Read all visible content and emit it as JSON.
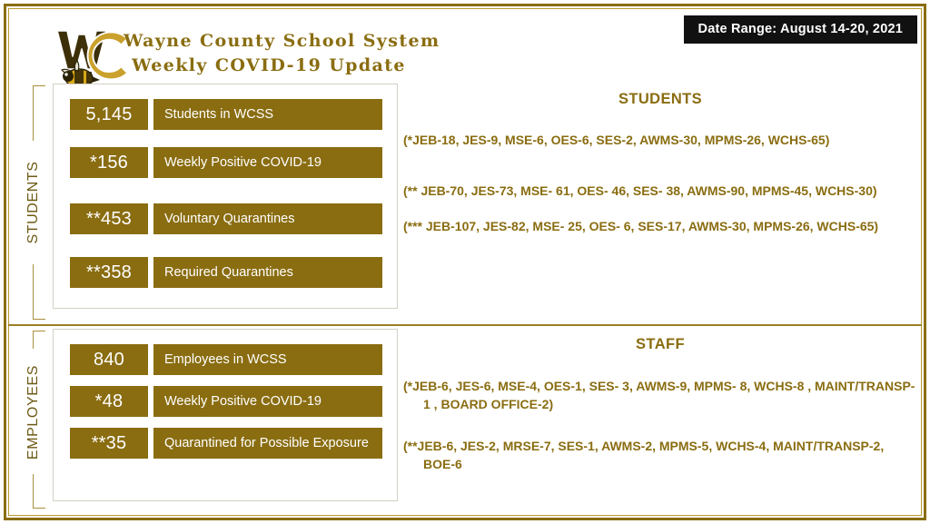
{
  "header": {
    "logo_alt": "wc-yellowjacket-logo",
    "title_line1": "Wayne County School System",
    "title_line2": "Weekly COVID-19 Update",
    "date_range": "Date Range: August 14-20, 2021"
  },
  "colors": {
    "brand_gold": "#8a6d11",
    "frame_gold": "#8a6d11",
    "date_bg": "#111111",
    "bar_text": "#ffffff",
    "box_border": "#d4d0c4"
  },
  "students": {
    "axis_label": "STUDENTS",
    "notes_heading": "STUDENTS",
    "rows": [
      {
        "value": "5,145",
        "label": "Students in WCSS"
      },
      {
        "value": "*156",
        "label": "Weekly Positive COVID-19"
      },
      {
        "value": "**453",
        "label": "Voluntary Quarantines"
      },
      {
        "value": "**358",
        "label": "Required Quarantines"
      }
    ],
    "notes": [
      "(*JEB-18, JES-9, MSE-6, OES-6, SES-2, AWMS-30, MPMS-26, WCHS-65)",
      "(** JEB-70, JES-73, MSE- 61, OES- 46, SES- 38, AWMS-90, MPMS-45, WCHS-30)",
      "(*** JEB-107, JES-82, MSE- 25, OES- 6, SES-17, AWMS-30, MPMS-26, WCHS-65)"
    ]
  },
  "employees": {
    "axis_label": "EMPLOYEES",
    "notes_heading": "STAFF",
    "rows": [
      {
        "value": "840",
        "label": "Employees in WCSS"
      },
      {
        "value": "*48",
        "label": "Weekly Positive COVID-19"
      },
      {
        "value": "**35",
        "label": "Quarantined for Possible Exposure"
      }
    ],
    "notes": [
      "(*JEB-6, JES-6, MSE-4, OES-1, SES- 3, AWMS-9, MPMS- 8, WCHS-8 , MAINT/TRANSP-1 , BOARD OFFICE-2)",
      "(**JEB-6, JES-2, MRSE-7, SES-1, AWMS-2, MPMS-5, WCHS-4, MAINT/TRANSP-2, BOE-6"
    ]
  }
}
